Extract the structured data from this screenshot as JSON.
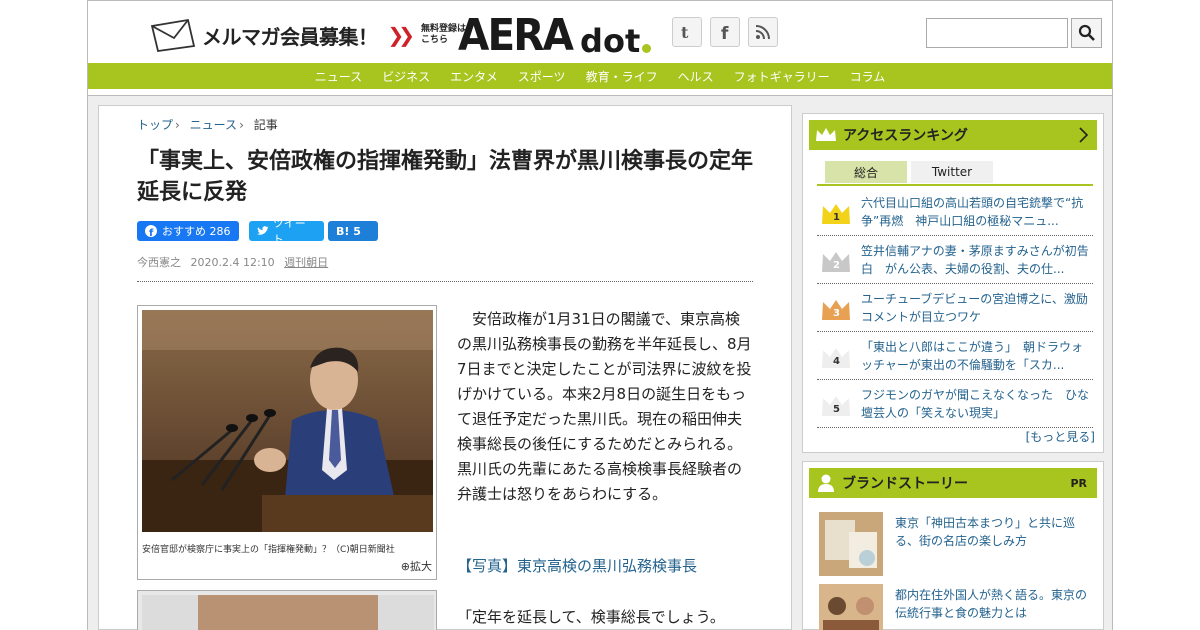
{
  "header": {
    "mailmag_label": "メルマガ会員募集！",
    "free_reg_line1": "無料登録は",
    "free_reg_line2": "こちら",
    "logo_main": "AERA",
    "logo_sub": "dot"
  },
  "nav": {
    "items": [
      "ニュース",
      "ビジネス",
      "エンタメ",
      "スポーツ",
      "教育・ライフ",
      "ヘルス",
      "フォトギャラリー",
      "コラム"
    ]
  },
  "breadcrumb": {
    "items": [
      "トップ",
      "ニュース",
      "記事"
    ]
  },
  "article": {
    "title": "「事実上、安倍政権の指揮権発動」法曹界が黒川検事長の定年延長に反発",
    "share_fb": "おすすめ 286",
    "share_tw": "ツイート",
    "share_hb": "B! 5",
    "author": "今西憲之",
    "date": "2020.2.4 12:10",
    "publication": "週刊朝日",
    "caption": "安倍官邸が検察庁に事実上の「指揮権発動」？（C)朝日新聞社",
    "zoom_label": "拡大",
    "body": "　安倍政権が1月31日の閣議で、東京高検の黒川弘務検事長の勤務を半年延長し、8月7日までと決定したことが司法界に波紋を投げかけている。本来2月8日の誕生日をもって退任予定だった黒川氏。現在の稲田伸夫検事総長の後任にするためだとみられる。黒川氏の先輩にあたる高検検事長経験者の弁護士は怒りをあらわにする。",
    "photo_link": "【写真】東京高検の黒川弘務検事長",
    "quote": "「定年を延長して、検事総長でしょう。"
  },
  "ranking": {
    "title": "アクセスランキング",
    "tabs": [
      "総合",
      "Twitter"
    ],
    "items": [
      {
        "rank": "1",
        "text": "六代目山口組の高山若頭の自宅銃撃で“抗争”再燃　神戸山口組の極秘マニュ..."
      },
      {
        "rank": "2",
        "text": "笠井信輔アナの妻・茅原ますみさんが初告白　がん公表、夫婦の役割、夫の仕..."
      },
      {
        "rank": "3",
        "text": "ユーチューブデビューの宮迫博之に、激励コメントが目立つワケ"
      },
      {
        "rank": "4",
        "text": "「東出と八郎はここが違う」　朝ドラウォッチャーが東出の不倫騒動を「スカ..."
      },
      {
        "rank": "5",
        "text": "フジモンのガヤが聞こえなくなった　ひな壇芸人の「笑えない現実」"
      }
    ],
    "more": "[もっと見る]"
  },
  "brand": {
    "title": "ブランドストーリー",
    "pr": "PR",
    "stories": [
      {
        "text": "東京「神田古本まつり」と共に巡る、街の名店の楽しみ方"
      },
      {
        "text": "都内在住外国人が熱く語る。東京の伝統行事と食の魅力とは"
      }
    ]
  },
  "colors": {
    "accent": "#a8c41e",
    "link": "#25638e",
    "facebook": "#1877f2",
    "twitter": "#1da1f2",
    "hatena": "#1d7fd8"
  }
}
